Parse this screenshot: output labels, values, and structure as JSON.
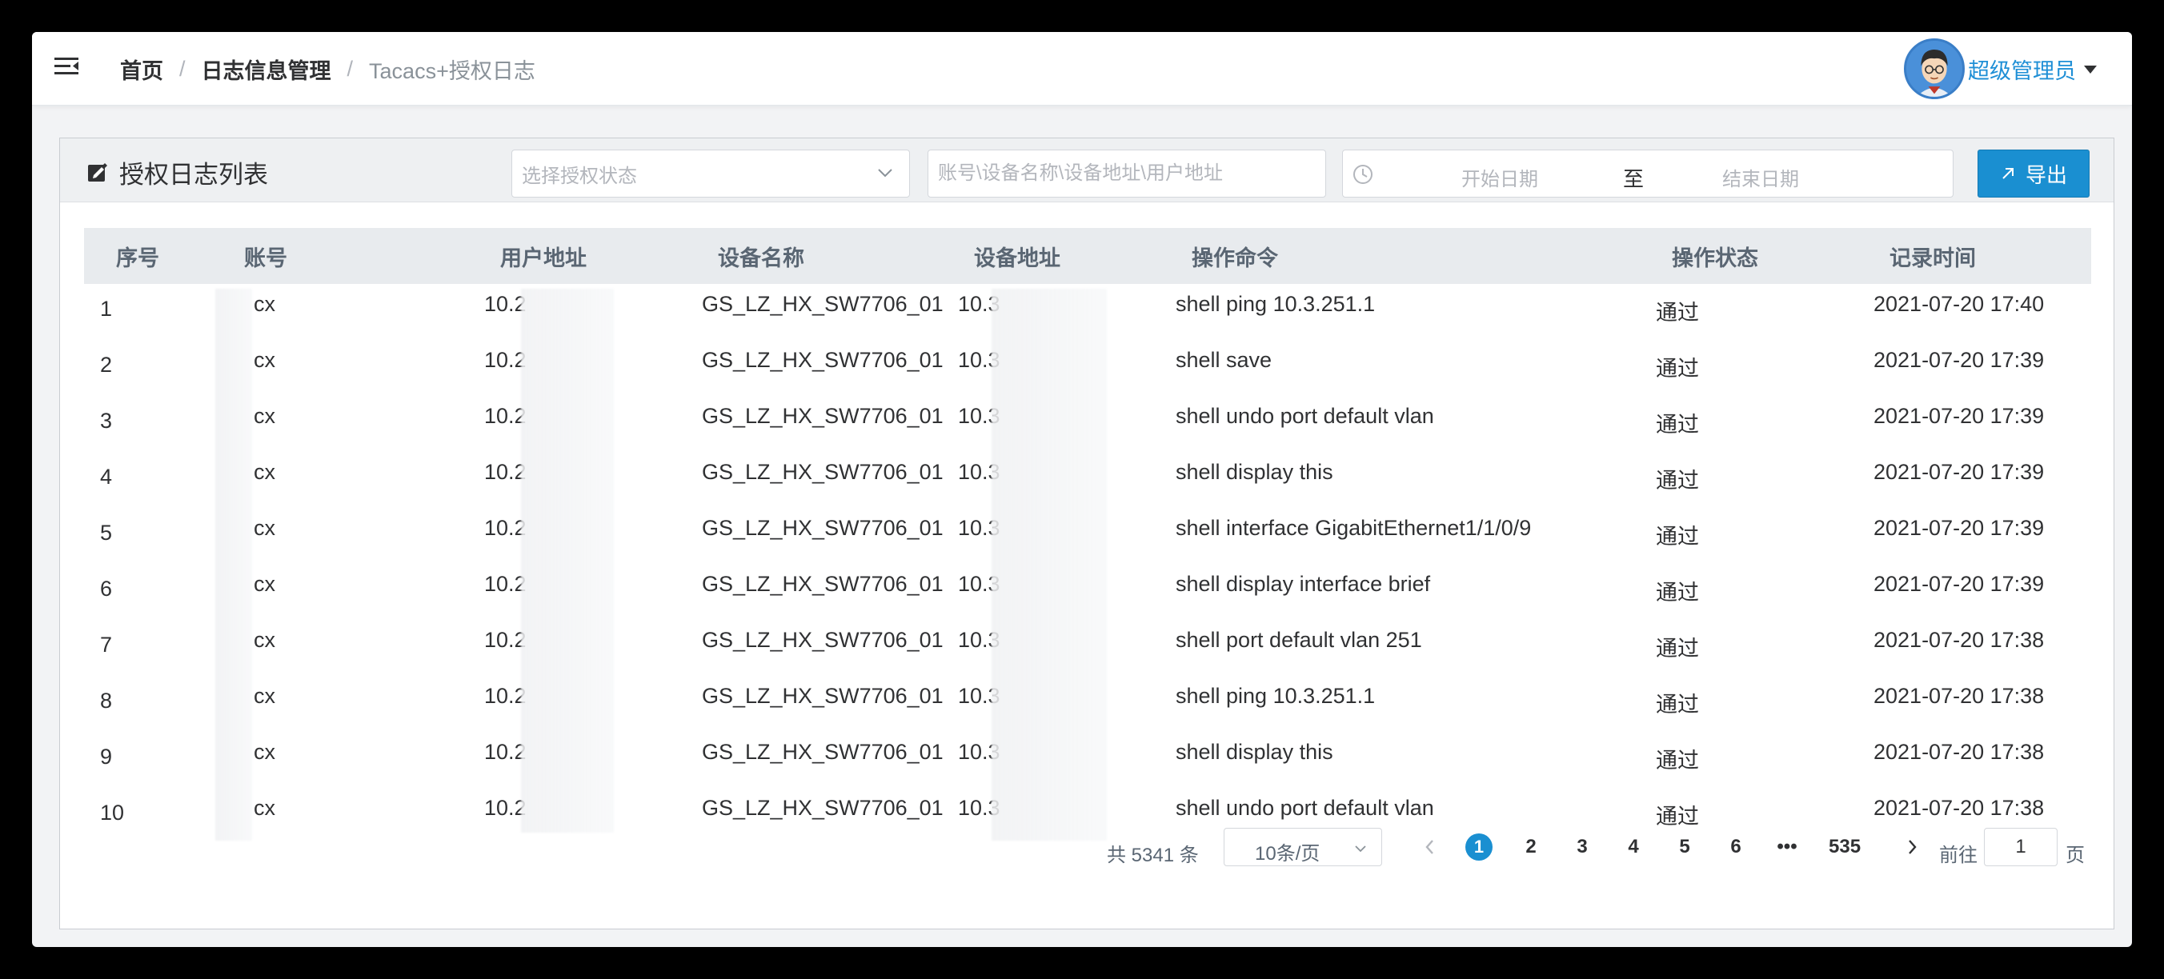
{
  "breadcrumb": {
    "home": "首页",
    "section": "日志信息管理",
    "current": "Tacacs+授权日志",
    "separator": "/"
  },
  "user": {
    "name": "超级管理员",
    "avatar_icon": "cartoon-avatar"
  },
  "panel": {
    "title": "授权日志列表",
    "status_select_placeholder": "选择授权状态",
    "search_placeholder": "账号\\设备名称\\设备地址\\用户地址",
    "date_start_placeholder": "开始日期",
    "date_separator": "至",
    "date_end_placeholder": "结束日期",
    "export_label": "导出"
  },
  "table": {
    "headers": [
      "序号",
      "账号",
      "用户地址",
      "设备名称",
      "设备地址",
      "操作命令",
      "操作状态",
      "记录时间"
    ],
    "rows": [
      {
        "idx": "1",
        "account": "cx",
        "user_addr": "10.2",
        "device_name": "GS_LZ_HX_SW7706_01",
        "device_addr": "10.3",
        "command": "shell ping 10.3.251.1",
        "status": "通过",
        "time": "2021-07-20 17:40"
      },
      {
        "idx": "2",
        "account": "cx",
        "user_addr": "10.2",
        "device_name": "GS_LZ_HX_SW7706_01",
        "device_addr": "10.3",
        "command": "shell save",
        "status": "通过",
        "time": "2021-07-20 17:39"
      },
      {
        "idx": "3",
        "account": "cx",
        "user_addr": "10.2",
        "device_name": "GS_LZ_HX_SW7706_01",
        "device_addr": "10.3",
        "command": "shell undo port default vlan",
        "status": "通过",
        "time": "2021-07-20 17:39"
      },
      {
        "idx": "4",
        "account": "cx",
        "user_addr": "10.2",
        "device_name": "GS_LZ_HX_SW7706_01",
        "device_addr": "10.3",
        "command": "shell display this",
        "status": "通过",
        "time": "2021-07-20 17:39"
      },
      {
        "idx": "5",
        "account": "cx",
        "user_addr": "10.2",
        "device_name": "GS_LZ_HX_SW7706_01",
        "device_addr": "10.3",
        "command": "shell interface GigabitEthernet1/1/0/9",
        "status": "通过",
        "time": "2021-07-20 17:39"
      },
      {
        "idx": "6",
        "account": "cx",
        "user_addr": "10.2",
        "device_name": "GS_LZ_HX_SW7706_01",
        "device_addr": "10.3",
        "command": "shell display interface brief",
        "status": "通过",
        "time": "2021-07-20 17:39"
      },
      {
        "idx": "7",
        "account": "cx",
        "user_addr": "10.2",
        "device_name": "GS_LZ_HX_SW7706_01",
        "device_addr": "10.3",
        "command": "shell port default vlan 251",
        "status": "通过",
        "time": "2021-07-20 17:38"
      },
      {
        "idx": "8",
        "account": "cx",
        "user_addr": "10.2",
        "device_name": "GS_LZ_HX_SW7706_01",
        "device_addr": "10.3",
        "command": "shell ping 10.3.251.1",
        "status": "通过",
        "time": "2021-07-20 17:38"
      },
      {
        "idx": "9",
        "account": "cx",
        "user_addr": "10.2",
        "device_name": "GS_LZ_HX_SW7706_01",
        "device_addr": "10.3",
        "command": "shell display this",
        "status": "通过",
        "time": "2021-07-20 17:38"
      },
      {
        "idx": "10",
        "account": "cx",
        "user_addr": "10.2",
        "device_name": "GS_LZ_HX_SW7706_01",
        "device_addr": "10.3",
        "command": "shell undo port default vlan",
        "status": "通过",
        "time": "2021-07-20 17:38"
      }
    ]
  },
  "pagination": {
    "total_text": "共 5341 条",
    "page_size_text": "10条/页",
    "pages": [
      "1",
      "2",
      "3",
      "4",
      "5",
      "6",
      "•••",
      "535"
    ],
    "active_page": "1",
    "goto_label": "前往",
    "goto_value": "1",
    "page_unit": "页"
  },
  "colors": {
    "accent": "#1a8fd1",
    "header_bg": "#e8ebee",
    "user_name": "#1f8fd6"
  }
}
